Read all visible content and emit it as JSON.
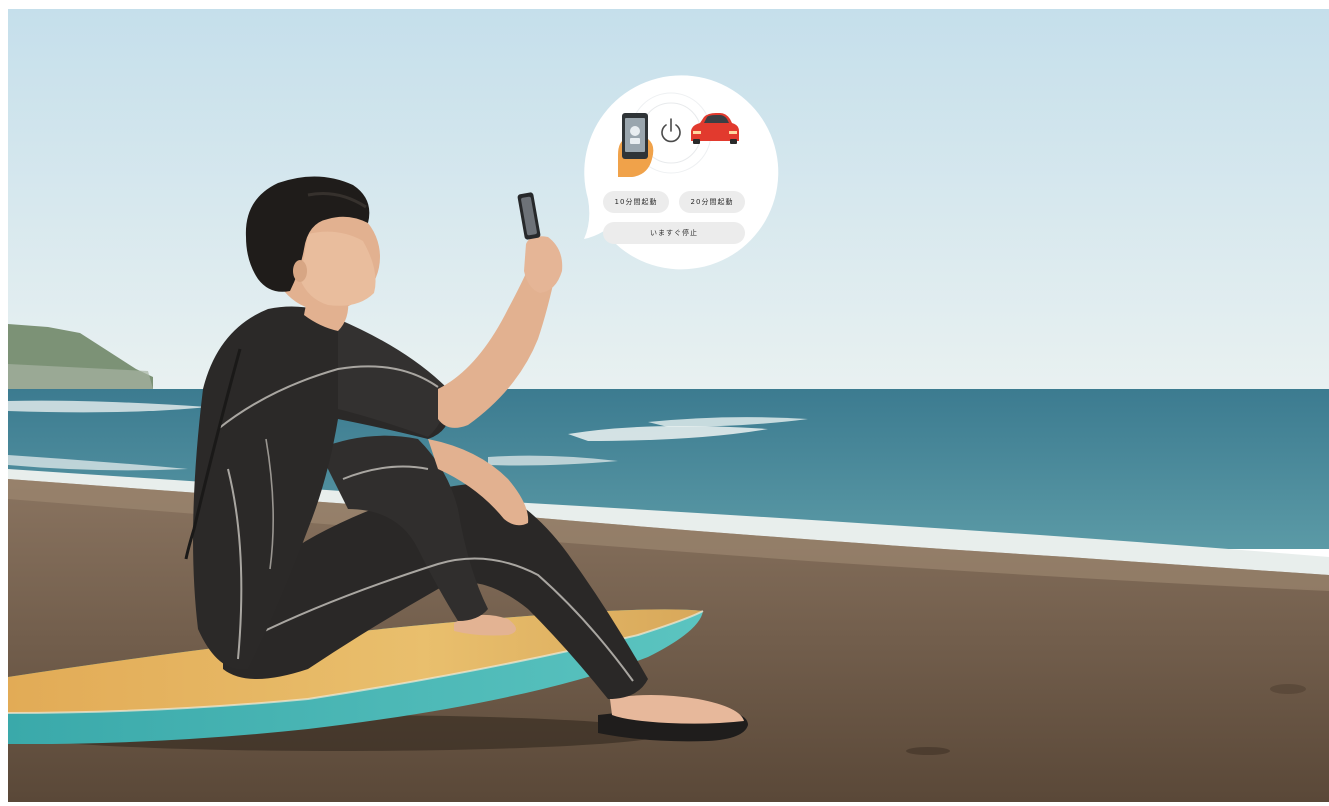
{
  "scene": {
    "icons": [
      "smartphone-hand-icon",
      "power-icon",
      "car-icon"
    ]
  },
  "remote_start": {
    "start_10min_label": "10分間起動",
    "start_20min_label": "20分間起動",
    "stop_now_label": "いますぐ停止"
  },
  "colors": {
    "sky_top": "#c8e0ec",
    "sea": "#2f6f84",
    "sand": "#6e5a48",
    "wetsuit": "#2c2a29",
    "car_red": "#e23a2e",
    "button_bg": "#ececec"
  }
}
